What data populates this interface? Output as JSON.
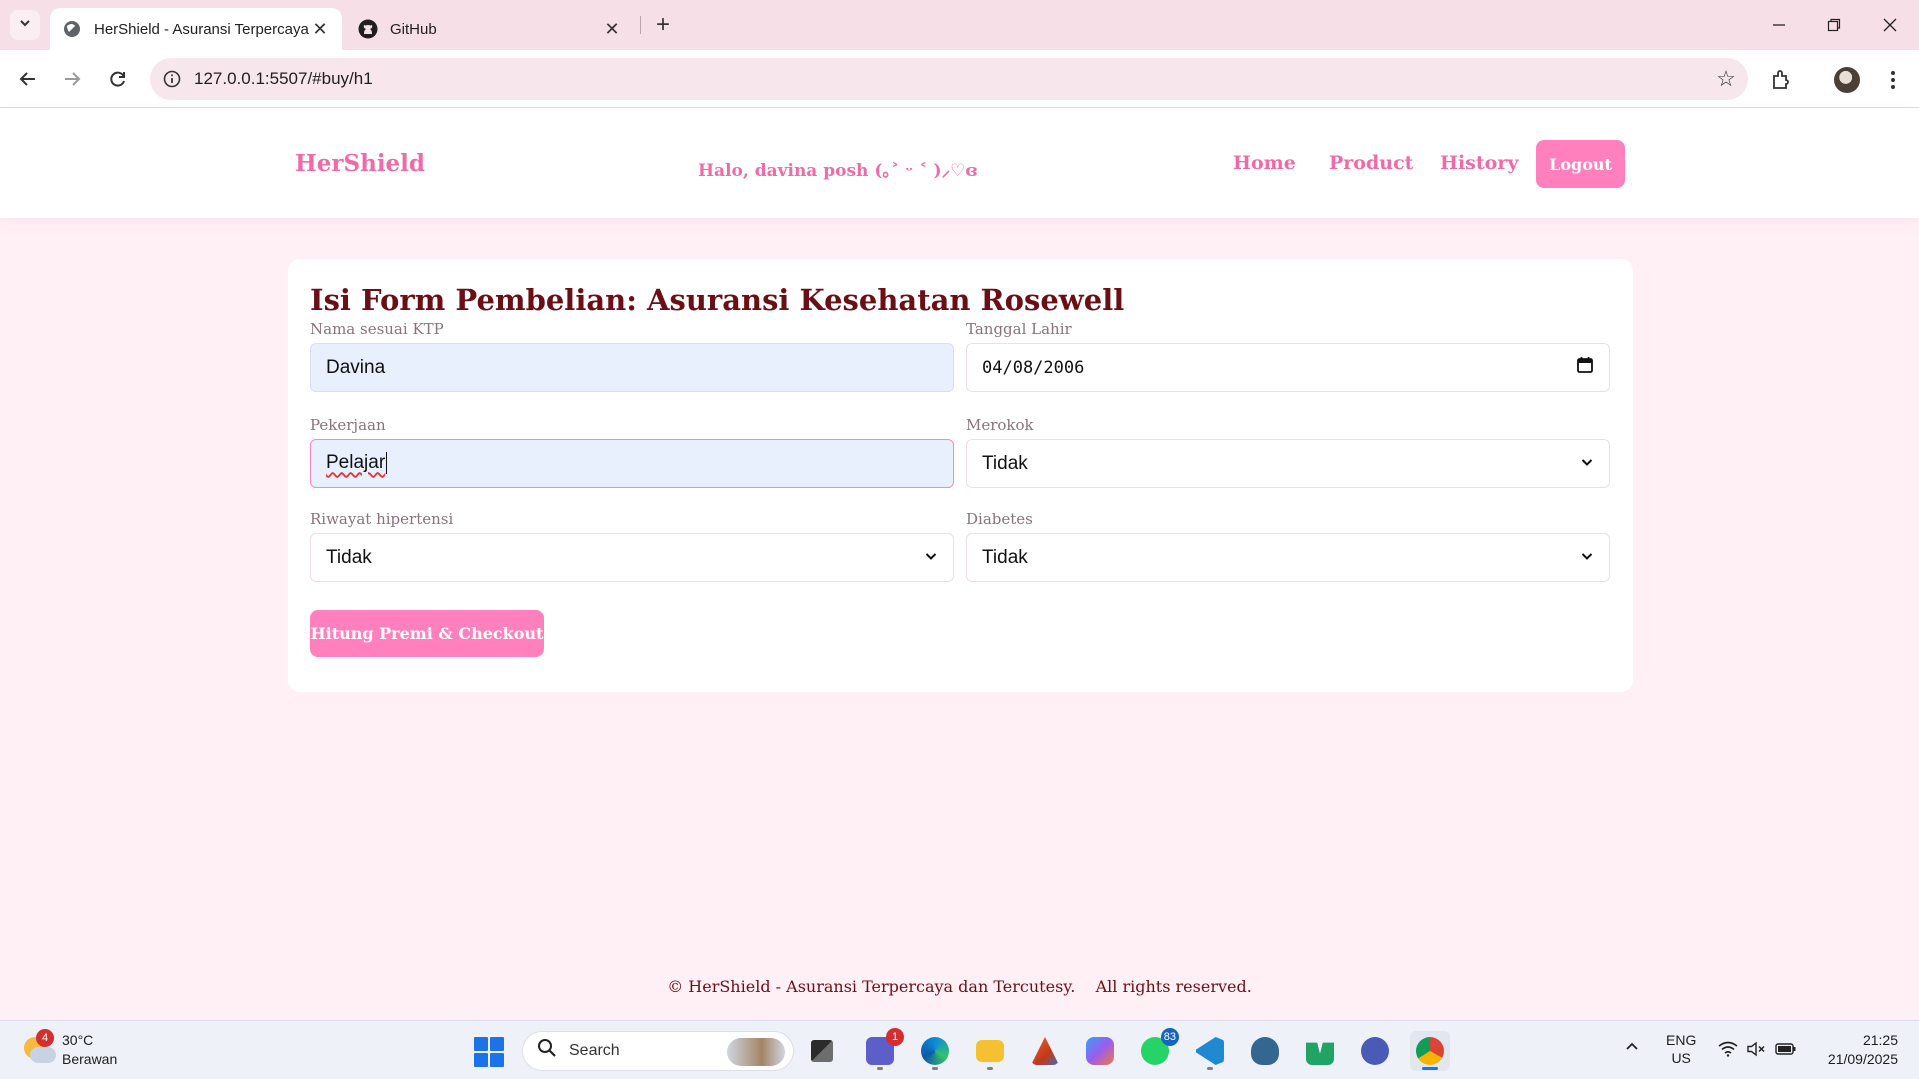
{
  "browser": {
    "tabs": [
      {
        "title": "HerShield - Asuransi Terpercaya",
        "icon": "globe-icon",
        "active": true
      },
      {
        "title": "GitHub",
        "icon": "github-icon",
        "active": false
      }
    ],
    "url": "127.0.0.1:5507/#buy/h1"
  },
  "header": {
    "brand": "HerShield",
    "greeting": "Halo, davina posh (｡˃ ᵕ ˂ )⸝♡ɞ",
    "nav": [
      "Home",
      "Product",
      "History"
    ],
    "logout": "Logout"
  },
  "form": {
    "title": "Isi Form Pembelian: Asuransi Kesehatan Rosewell",
    "fields": {
      "nama": {
        "label": "Nama sesuai KTP",
        "value": "Davina"
      },
      "tanggal_lahir": {
        "label": "Tanggal Lahir",
        "value": "04/08/2006"
      },
      "pekerjaan": {
        "label": "Pekerjaan",
        "value": "Pelajar"
      },
      "merokok": {
        "label": "Merokok",
        "value": "Tidak"
      },
      "hipertensi": {
        "label": "Riwayat hipertensi",
        "value": "Tidak"
      },
      "diabetes": {
        "label": "Diabetes",
        "value": "Tidak"
      }
    },
    "submit": "Hitung Premi & Checkout"
  },
  "footer": {
    "text": "© HerShield - Asuransi Terpercaya dan Tercutesy.    All rights reserved."
  },
  "colors": {
    "accent": "#ff80bd",
    "brand_text": "#f06aa8",
    "title_text": "#6b0f16",
    "page_bg": "#fff0f5"
  },
  "taskbar": {
    "weather": {
      "temp": "30°C",
      "condition": "Berawan",
      "badge": "4"
    },
    "search_placeholder": "Search",
    "badges": {
      "teams": "1",
      "whatsapp": "83"
    },
    "lang": {
      "line1": "ENG",
      "line2": "US"
    },
    "time": "21:25",
    "date": "21/09/2025"
  }
}
